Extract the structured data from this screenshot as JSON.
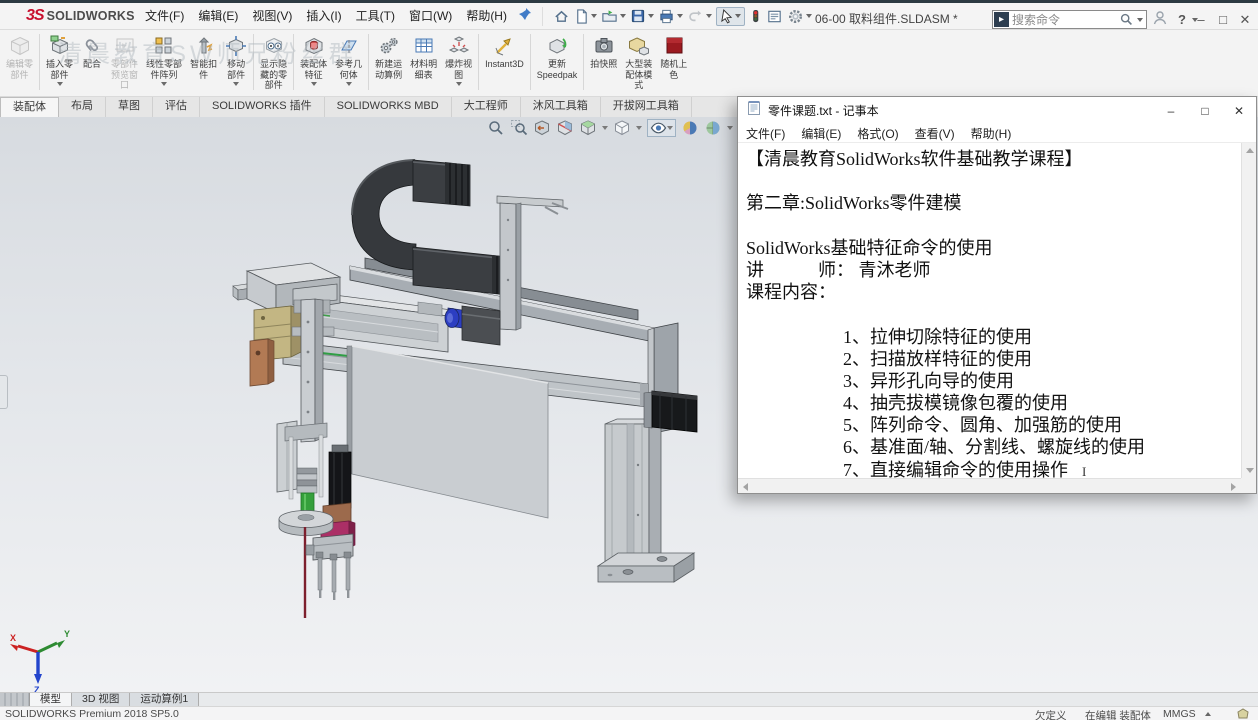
{
  "titlebar": {
    "brand_glyph": "3S",
    "brand": "SOLIDWORKS",
    "menus": [
      "文件(F)",
      "编辑(E)",
      "视图(V)",
      "插入(I)",
      "工具(T)",
      "窗口(W)",
      "帮助(H)"
    ],
    "document_title": "06-00 取料组件.SLDASM *",
    "search_placeholder": "搜索命令",
    "help_label": "?"
  },
  "watermark": "清晨教育SW师兄粉丝群",
  "ribbon": {
    "buttons": [
      {
        "label": "编辑零\n部件",
        "disabled": true
      },
      {
        "label": "插入零\n部件",
        "dropdown": true
      },
      {
        "label": "配合"
      },
      {
        "label": "零部件\n预览窗\n口",
        "disabled": true
      },
      {
        "label": "线性零部\n件阵列",
        "dropdown": true
      },
      {
        "label": "智能扣\n件"
      },
      {
        "label": "移动\n部件",
        "dropdown": true
      },
      {
        "label": "显示隐\n藏的零\n部件"
      },
      {
        "label": "装配体\n特征",
        "dropdown": true
      },
      {
        "label": "参考几\n何体",
        "dropdown": true
      },
      {
        "label": "新建运\n动算例"
      },
      {
        "label": "材料明\n细表"
      },
      {
        "label": "爆炸视\n图",
        "dropdown": true
      },
      {
        "label": "Instant3D"
      },
      {
        "label": "更新\nSpeedpak"
      },
      {
        "label": "拍快照"
      },
      {
        "label": "大型装\n配体模\n式"
      },
      {
        "label": "随机上\n色"
      }
    ],
    "tabs": [
      "装配体",
      "布局",
      "草图",
      "评估",
      "SOLIDWORKS 插件",
      "SOLIDWORKS MBD",
      "大工程师",
      "沐风工具箱",
      "开拔网工具箱"
    ],
    "active_tab": "装配体"
  },
  "notepad": {
    "title": "零件课题.txt - 记事本",
    "menus": [
      "文件(F)",
      "编辑(E)",
      "格式(O)",
      "查看(V)",
      "帮助(H)"
    ],
    "lines": [
      "【清晨教育SolidWorks软件基础教学课程】",
      "",
      "第二章:SolidWorks零件建模",
      "",
      "SolidWorks基础特征命令的使用",
      "讲　　　师： 青沐老师",
      "课程内容：",
      "",
      "1、拉伸切除特征的使用",
      "2、扫描放样特征的使用",
      "3、异形孔向导的使用",
      "4、抽壳拔模镜像包覆的使用",
      "5、阵列命令、圆角、加强筋的使用",
      "6、基准面/轴、分割线、螺旋线的使用",
      "7、直接编辑命令的使用操作"
    ]
  },
  "viewport": {
    "triad_labels": {
      "x": "X",
      "y": "Y",
      "z": "Z"
    }
  },
  "bottom": {
    "tabs": [
      "模型",
      "3D 视图",
      "运动算例1"
    ],
    "active_tab": "模型",
    "status_left": "SOLIDWORKS Premium 2018 SP5.0",
    "status_items": [
      "欠定义",
      "在编辑 装配体",
      "MMGS"
    ]
  },
  "colors": {
    "brand_red": "#c8102e",
    "duct_dark": "#3a3d41",
    "part_gray": "#c9cdd1",
    "beige": "#c3b683",
    "green": "#35a03c",
    "magenta": "#ab2f66",
    "needle_red": "#7d1f2d",
    "blue_part": "#2c3ec2"
  }
}
